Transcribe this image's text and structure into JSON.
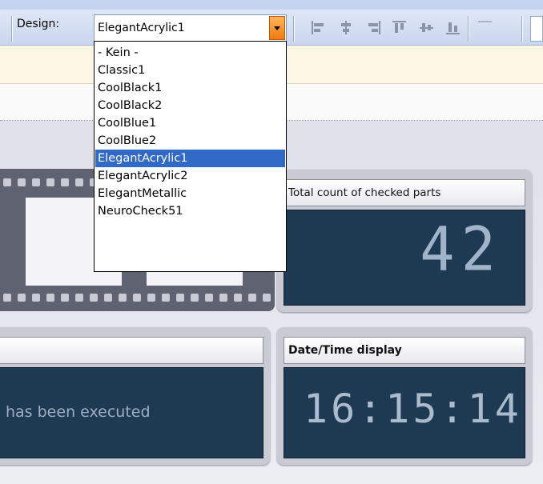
{
  "toolbar": {
    "design_label": "Design:",
    "design_selected": "ElegantAcrylic1",
    "tools": [
      {
        "icon": "align-left-icon"
      },
      {
        "icon": "align-center-icon"
      },
      {
        "icon": "align-right-icon"
      },
      {
        "icon": "align-top-icon"
      },
      {
        "icon": "align-middle-icon"
      },
      {
        "icon": "align-bottom-icon"
      }
    ]
  },
  "design_dropdown": {
    "options": [
      "- Kein -",
      "Classic1",
      "CoolBlack1",
      "CoolBlack2",
      "CoolBlue1",
      "CoolBlue2",
      "ElegantAcrylic1",
      "ElegantAcrylic2",
      "ElegantMetallic",
      "NeuroCheck51"
    ],
    "selected_index": 6
  },
  "panels": {
    "count": {
      "title": "Total count of checked parts",
      "value": "42"
    },
    "message": {
      "title": "",
      "text": "has been executed"
    },
    "datetime": {
      "title": "Date/Time display",
      "value": "16:15:14"
    }
  },
  "colors": {
    "selection": "#3169c6",
    "display_bg": "#1e3952",
    "accent_orange": "#f07a10"
  }
}
